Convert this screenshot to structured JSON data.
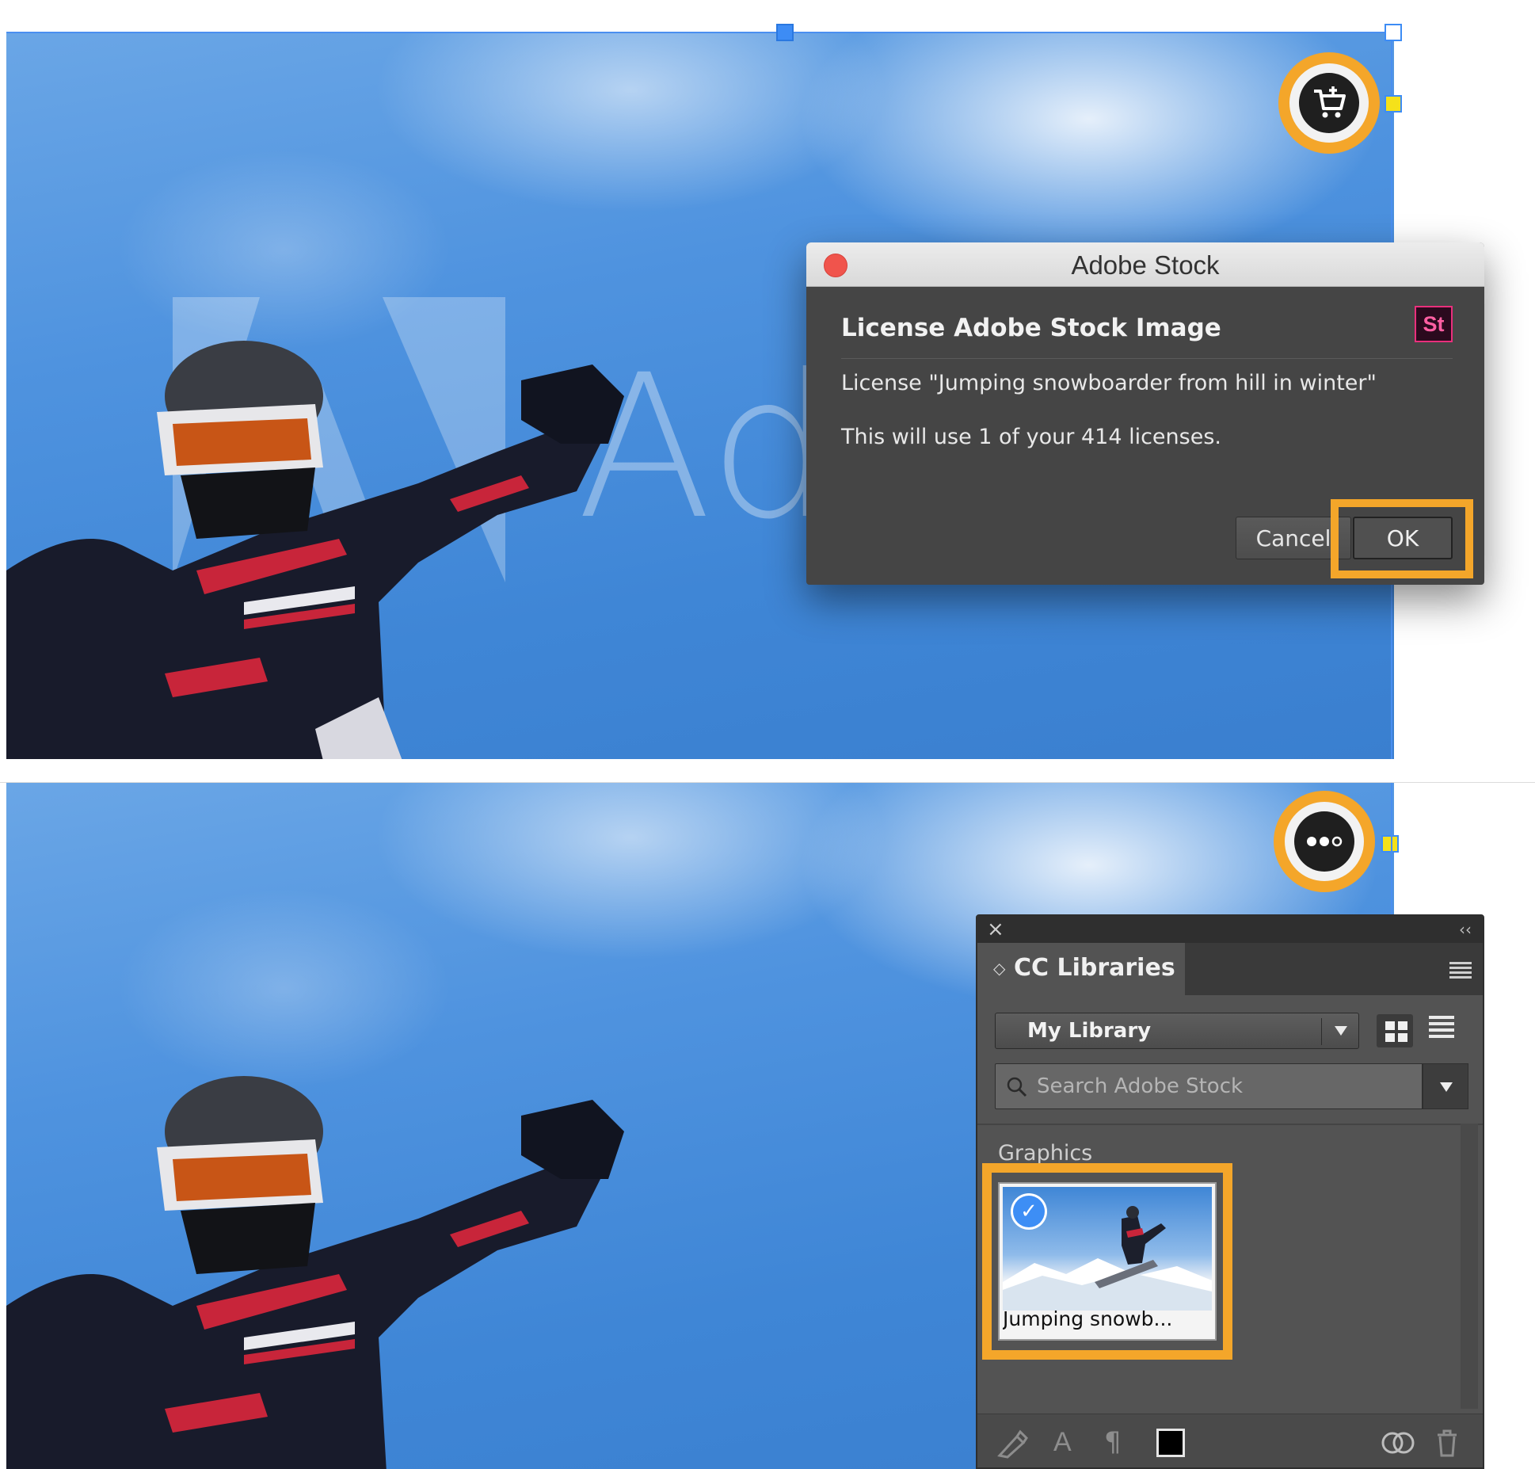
{
  "top_scene": {
    "watermark_text": "Ad",
    "badge_icon": "cart-plus-icon",
    "dialog": {
      "window_title": "Adobe Stock",
      "heading": "License Adobe Stock Image",
      "stock_logo": "St",
      "license_line": "License \"Jumping snowboarder from hill in winter\"",
      "usage_line": "This will use 1 of your 414 licenses.",
      "cancel_label": "Cancel",
      "ok_label": "OK"
    }
  },
  "bottom_scene": {
    "badge_icon": "more-options-icon",
    "panel": {
      "close_glyph": "×",
      "collapse_glyph": "‹‹",
      "tab_label": "CC Libraries",
      "library_selected": "My Library",
      "search_placeholder": "Search Adobe Stock",
      "section_label": "Graphics",
      "asset_caption": "Jumping snowb...",
      "asset_check": "✓",
      "footer_icons": [
        "brush-icon",
        "character-style-icon",
        "paragraph-style-icon",
        "color-swatch-icon",
        "creative-cloud-icon",
        "trash-icon"
      ]
    }
  },
  "colors": {
    "highlight_orange": "#f4a62a",
    "selection_blue": "#4a8ff0",
    "handle_yellow": "#f5e11a",
    "dialog_bg": "#454545",
    "panel_bg": "#535353"
  }
}
